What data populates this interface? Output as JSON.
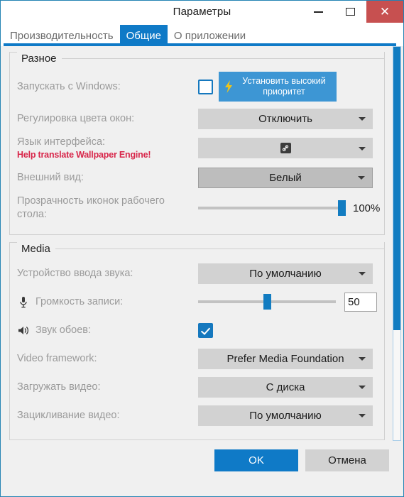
{
  "window": {
    "title": "Параметры",
    "controls": {
      "minimize": "–",
      "maximize": "□",
      "close": "✕"
    },
    "close_color": "#c75050",
    "accent_color": "#0f7ac7",
    "border_color": "#2484b4"
  },
  "tabs": [
    {
      "label": "Производительность",
      "active": false
    },
    {
      "label": "Общие",
      "active": true
    },
    {
      "label": "О приложении",
      "active": false
    }
  ],
  "groups": [
    {
      "title": "Разное",
      "rows": [
        {
          "label": "Запускать с Windows:",
          "control": "checkbox-plus-button",
          "checked": false,
          "button_label": "Установить высокий приоритет",
          "button_icon": "lightning-bolt-icon",
          "button_color": "#3d96d4",
          "icon_color": "#f0c419"
        },
        {
          "label": "Регулировка цвета окон:",
          "control": "combobox",
          "value": "Отключить"
        },
        {
          "label": "Язык интерфейса:",
          "sublabel": "Help translate Wallpaper Engine!",
          "sublabel_color": "#d8264a",
          "control": "combobox",
          "value": "",
          "value_icon": "steam-icon"
        },
        {
          "label": "Внешний вид:",
          "control": "combobox",
          "value": "Белый",
          "hover": true
        },
        {
          "label": "Прозрачность иконок рабочего стола:",
          "control": "slider",
          "value": 100,
          "value_text": "100%",
          "min": 0,
          "max": 100
        }
      ]
    },
    {
      "title": "Media",
      "rows": [
        {
          "label": "Устройство ввода звука:",
          "control": "combobox",
          "value": "По умолчанию"
        },
        {
          "label": "Громкость записи:",
          "icon": "microphone-icon",
          "control": "slider-spinbox",
          "value": 50,
          "value_text": "50",
          "min": 0,
          "max": 100
        },
        {
          "label": "Звук обоев:",
          "icon": "speaker-icon",
          "control": "checkbox",
          "checked": true
        },
        {
          "label": "Video framework:",
          "control": "combobox",
          "value": "Prefer Media Foundation"
        },
        {
          "label": "Загружать видео:",
          "control": "combobox",
          "value": "С диска"
        },
        {
          "label": "Зацикливание видео:",
          "control": "combobox",
          "value": "По умолчанию"
        }
      ]
    }
  ],
  "scrollbar": {
    "thumb_percent": 72
  },
  "footer": {
    "ok_label": "OK",
    "cancel_label": "Отмена"
  }
}
